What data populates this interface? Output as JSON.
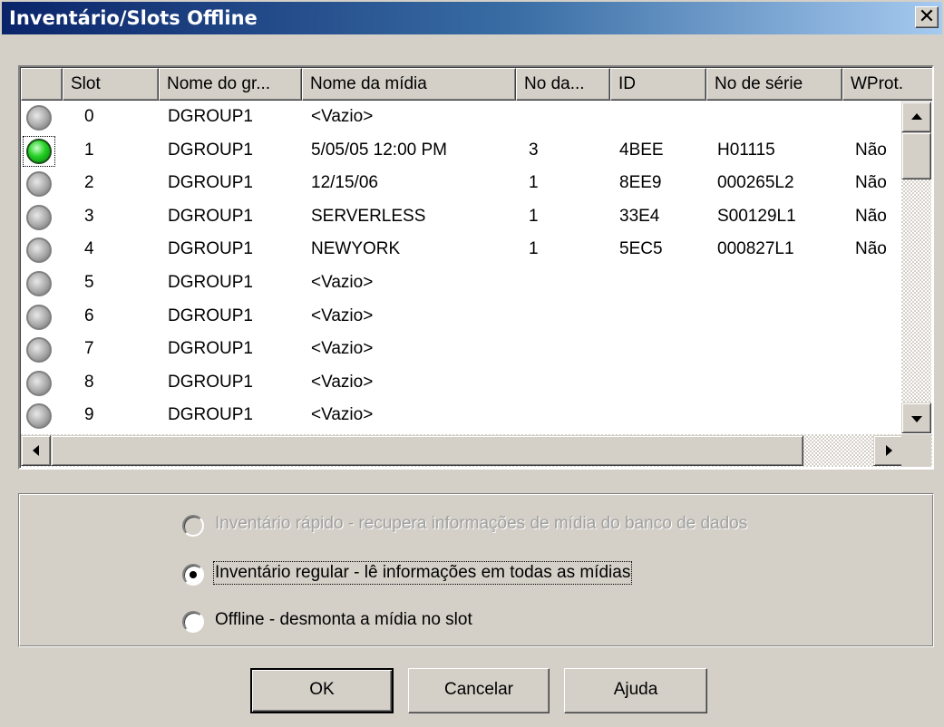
{
  "window": {
    "title": "Inventário/Slots Offline",
    "close_glyph": "✕"
  },
  "list": {
    "columns": [
      "",
      "Slot",
      "Nome do gr...",
      "Nome da mídia",
      "No da...",
      "ID",
      "No de série",
      "WProt."
    ],
    "rows": [
      {
        "status": "off",
        "slot": "0",
        "group": "DGROUP1",
        "media": "<Vazio>",
        "no": "",
        "id": "",
        "serial": "",
        "wprot": ""
      },
      {
        "status": "on",
        "slot": "1",
        "group": "DGROUP1",
        "media": "5/05/05 12:00 PM",
        "no": "3",
        "id": "4BEE",
        "serial": "H01115",
        "wprot": "Não"
      },
      {
        "status": "off",
        "slot": "2",
        "group": "DGROUP1",
        "media": "12/15/06",
        "no": "1",
        "id": "8EE9",
        "serial": "000265L2",
        "wprot": "Não"
      },
      {
        "status": "off",
        "slot": "3",
        "group": "DGROUP1",
        "media": "SERVERLESS",
        "no": "1",
        "id": "33E4",
        "serial": "S00129L1",
        "wprot": "Não"
      },
      {
        "status": "off",
        "slot": "4",
        "group": "DGROUP1",
        "media": "NEWYORK",
        "no": "1",
        "id": "5EC5",
        "serial": "000827L1",
        "wprot": "Não"
      },
      {
        "status": "off",
        "slot": "5",
        "group": "DGROUP1",
        "media": "<Vazio>",
        "no": "",
        "id": "",
        "serial": "",
        "wprot": ""
      },
      {
        "status": "off",
        "slot": "6",
        "group": "DGROUP1",
        "media": "<Vazio>",
        "no": "",
        "id": "",
        "serial": "",
        "wprot": ""
      },
      {
        "status": "off",
        "slot": "7",
        "group": "DGROUP1",
        "media": "<Vazio>",
        "no": "",
        "id": "",
        "serial": "",
        "wprot": ""
      },
      {
        "status": "off",
        "slot": "8",
        "group": "DGROUP1",
        "media": "<Vazio>",
        "no": "",
        "id": "",
        "serial": "",
        "wprot": ""
      },
      {
        "status": "off",
        "slot": "9",
        "group": "DGROUP1",
        "media": "<Vazio>",
        "no": "",
        "id": "",
        "serial": "",
        "wprot": ""
      }
    ]
  },
  "options": {
    "quick": "Inventário rápido - recupera informações de mídia do banco de dados",
    "regular": "Inventário regular - lê informações em todas as mídias",
    "offline": "Offline - desmonta a mídia no slot",
    "selected": "regular"
  },
  "buttons": {
    "ok": "OK",
    "cancel": "Cancelar",
    "help": "Ajuda"
  },
  "colors": {
    "face": "#d4d0c8",
    "title_start": "#0a246a",
    "title_end": "#a6caf0",
    "led_on": "#22d022"
  },
  "icons": {
    "status_on": "green-led-icon",
    "status_off": "gray-led-icon"
  }
}
